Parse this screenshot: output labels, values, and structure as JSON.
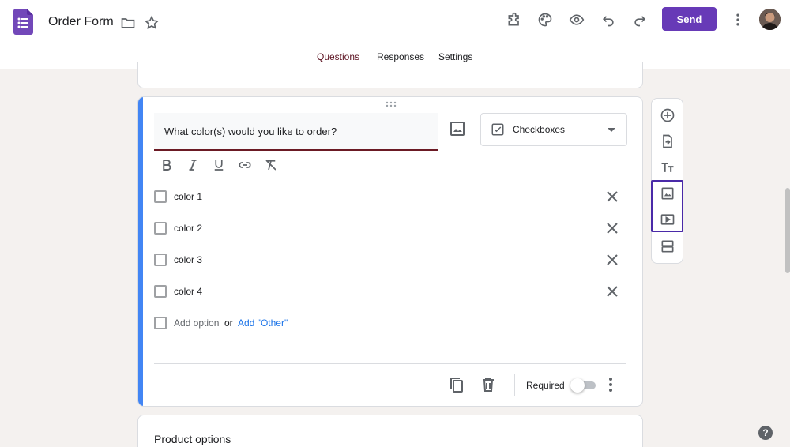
{
  "header": {
    "title": "Order Form",
    "send_label": "Send",
    "icons": [
      "folder-icon",
      "star-icon",
      "addon-icon",
      "palette-icon",
      "preview-icon",
      "undo-icon",
      "redo-icon",
      "more-icon"
    ]
  },
  "tabs": [
    {
      "label": "Questions",
      "active": true
    },
    {
      "label": "Responses",
      "active": false
    },
    {
      "label": "Settings",
      "active": false
    }
  ],
  "question": {
    "text": "What color(s) would you like to order?",
    "type_label": "Checkboxes",
    "options": [
      {
        "label": "color 1"
      },
      {
        "label": "color 2"
      },
      {
        "label": "color 3"
      },
      {
        "label": "color 4"
      }
    ],
    "add_option_label": "Add option",
    "or_label": "or",
    "add_other_label": "Add \"Other\"",
    "required_label": "Required",
    "required": false
  },
  "next_card": {
    "title": "Product options"
  },
  "toolbar": {
    "items": [
      "add-question-icon",
      "import-questions-icon",
      "add-title-icon",
      "add-image-icon",
      "add-video-icon",
      "add-section-icon"
    ]
  },
  "help_label": "?",
  "colors": {
    "accent": "#673ab7",
    "active_tab": "#6b1a24",
    "card_accent": "#4285f4",
    "link": "#1a73e8",
    "background": "#f4f1ef"
  }
}
